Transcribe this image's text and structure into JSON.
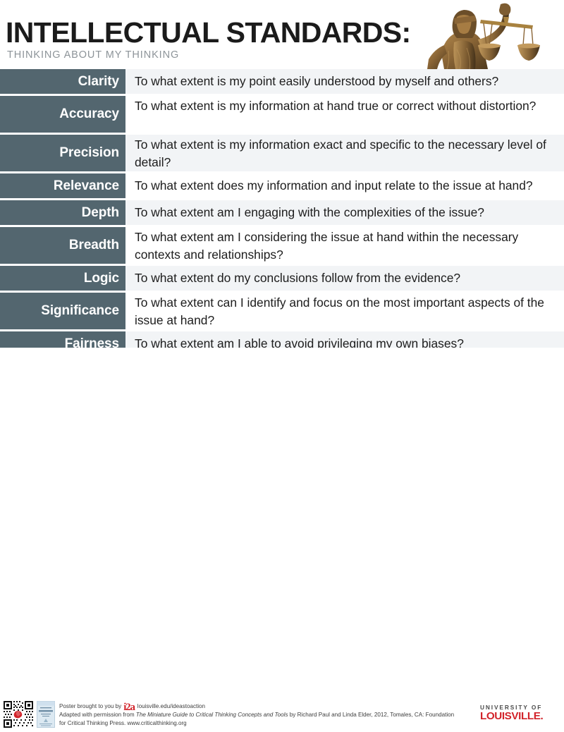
{
  "header": {
    "title": "INTELLECTUAL STANDARDS:",
    "subtitle": "THINKING ABOUT MY THINKING",
    "statue_icon": "lady-justice-scales-statue"
  },
  "colors": {
    "label_bg": "#53666f",
    "row_alt_bg": "#f2f4f6",
    "row_plain_bg": "#ffffff",
    "brand_red": "#d2232a",
    "title_color": "#1b1b1b",
    "subtitle_color": "#8d9499"
  },
  "standards": [
    {
      "label": "Clarity",
      "question": "To what extent is my point easily understood by myself and others?"
    },
    {
      "label": "Accuracy",
      "question": "To what extent is my information at hand true or correct without distortion?"
    },
    {
      "label": "Precision",
      "question": "To what extent is my information exact and specific to the necessary level of detail?"
    },
    {
      "label": "Relevance",
      "question": "To what extent does my information and input relate to the issue at hand?"
    },
    {
      "label": "Depth",
      "question": "To what extent am I engaging with the complexities of the issue?"
    },
    {
      "label": "Breadth",
      "question": "To what extent am I considering the issue at hand within the necessary contexts and relationships?"
    },
    {
      "label": "Logic",
      "question": "To what extent do my conclusions follow from the evidence?"
    },
    {
      "label": "Significance",
      "question": "To what extent can I identify and focus on the most important aspects of the issue at hand?"
    },
    {
      "label": "Fairness",
      "question": "To what extent am I able to avoid privileging my own biases?"
    }
  ],
  "footer": {
    "qr_icon": "qr-code-with-cardinal-logo",
    "booklet_icon": "critical-thinking-guide-booklet-thumbnail",
    "brought_to_you_by": "Poster brought to you by",
    "i2a_logo": "i2a",
    "i2a_url": "louisville.edu/ideastoaction",
    "adapted_prefix": "Adapted with permission from",
    "adapted_title": "The Miniature Guide to Critical Thinking Concepts and Tools",
    "adapted_suffix": "by Richard Paul and Linda Elder, 2012, Tomales, CA: Foundation",
    "adapted_line3": "for Critical Thinking Press. www.criticalthinking.org",
    "university_top": "UNIVERSITY OF",
    "university_bottom": "LOUISVILLE."
  }
}
